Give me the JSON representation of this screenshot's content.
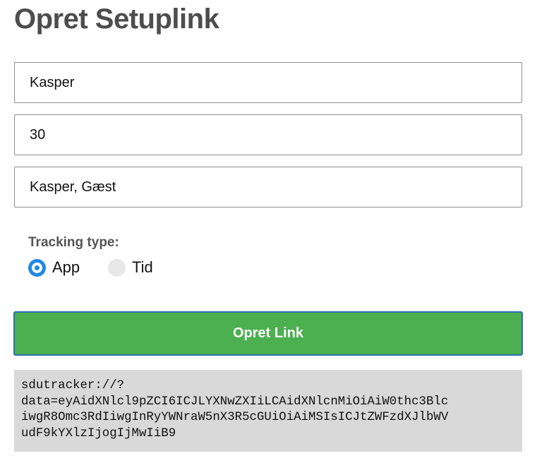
{
  "header": {
    "title": "Opret Setuplink"
  },
  "form": {
    "name_value": "Kasper",
    "number_value": "30",
    "guests_value": "Kasper, Gæst"
  },
  "tracking": {
    "label": "Tracking type:",
    "options": [
      {
        "label": "App",
        "selected": true
      },
      {
        "label": "Tid",
        "selected": false
      }
    ]
  },
  "actions": {
    "submit_label": "Opret Link"
  },
  "output": {
    "link_text": "sdutracker://?\ndata=eyAidXNlcl9pZCI6ICJLYXNwZXIiLCAidXNlcnMiOiAiW0thc3Blc\niwgR8Omc3RdIiwgInRyYWNraW5nX3R5cGUiOiAiMSIsICJtZWFzdXJlbWV\nudF9kYXlzIjogIjMwIiB9"
  },
  "colors": {
    "accent": "#4caf50",
    "radio_selected": "#1e88e5",
    "button_border": "#2a6fb3",
    "output_background": "#d9d9d9"
  }
}
